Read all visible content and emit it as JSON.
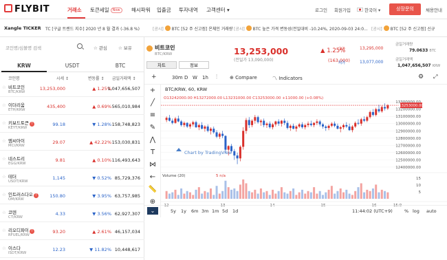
{
  "brand": {
    "name": "FLYBIT"
  },
  "nav": {
    "items": [
      {
        "label": "거래소",
        "active": true
      },
      {
        "label": "토큰세일",
        "badge": "Now"
      },
      {
        "label": "해시파워"
      },
      {
        "label": "입출금"
      },
      {
        "label": "투자내역"
      },
      {
        "label": "고객센터 ▾"
      }
    ],
    "login": "로그인",
    "signup": "회원가입",
    "language": "한국어 ▾",
    "cta": "상장문의",
    "recruit": "채용안내"
  },
  "ticker": {
    "title": "Xangle TICKER",
    "items": [
      {
        "text": "TC [구글 트렌드 지수] 2020 년 8 월 결과 (-36.8 %)"
      },
      {
        "tag": "[공시]",
        "coin": "BTC",
        "text": "[52 주 신고점] 온체인 거래량"
      },
      {
        "tag": "[공시]",
        "coin": "BTC",
        "text": "높은 가격 변동성(전일대비 -10.24%, 2020-09-03 24:0..."
      },
      {
        "tag": "[공시]",
        "coin": "BTC",
        "text": "[52 주 신고점] 신규"
      }
    ]
  },
  "market": {
    "search_placeholder": "코인명/심볼명 검색",
    "favorites": "관심",
    "holdings": "보유",
    "tabs": [
      "KRW",
      "USDT",
      "BTC"
    ],
    "columns": [
      "코인명",
      "시세 ↕",
      "변동률 ↕",
      "금일거래액 ↕"
    ],
    "rows": [
      {
        "name": "비트코인",
        "code": "BTC/KRW",
        "price": "13,253,000",
        "change": "▲ 1.25%",
        "dir": "up",
        "volume": "1,047,656,507"
      },
      {
        "name": "이더리움",
        "code": "ETH/KRW",
        "price": "435,400",
        "change": "▲ 0.69%",
        "dir": "up",
        "volume": "565,010,984"
      },
      {
        "name": "키보드토큰",
        "code": "KEYT/KRW",
        "price": "99.18",
        "change": "▼ 1.28%",
        "dir": "dn",
        "volume": "158,748,823",
        "warn": true
      },
      {
        "name": "엠씨아이",
        "code": "MCI/KRW",
        "price": "29.07",
        "change": "▲ 42.22%",
        "dir": "up",
        "volume": "153,030,831"
      },
      {
        "name": "네스트리",
        "code": "EGG/KRW",
        "price": "9.81",
        "change": "▲ 0.10%",
        "dir": "up",
        "volume": "116,493,643"
      },
      {
        "name": "테더",
        "code": "USDT/KRW",
        "price": "1,145",
        "change": "▼ 0.52%",
        "dir": "dn",
        "volume": "85,729,376"
      },
      {
        "name": "인트러스다오",
        "code": "OM/KRW",
        "price": "150.80",
        "change": "▼ 3.95%",
        "dir": "dn",
        "volume": "63,757,985",
        "warn": true
      },
      {
        "name": "코텐",
        "code": "CT/KRW",
        "price": "4.33",
        "change": "▼ 3.56%",
        "dir": "dn",
        "volume": "62,927,307"
      },
      {
        "name": "리오디파이",
        "code": "RFUEL/KRW",
        "price": "93.20",
        "change": "▲ 2.61%",
        "dir": "up",
        "volume": "46,157,034",
        "warn": true
      },
      {
        "name": "이스다",
        "code": "ISDT/KRW",
        "price": "12.23",
        "change": "▼ 11.82%",
        "dir": "dn",
        "volume": "10,448,617"
      }
    ]
  },
  "detail": {
    "name": "비트코인",
    "code": "BTC/KRW",
    "price": "13,253,000",
    "prev": "(전일가 13,090,000)",
    "change_pct": "▲ 1.25%",
    "change_abs": "(163,000)",
    "high_label": "고가",
    "high": "13,295,000",
    "low_label": "저가",
    "low": "13,077,000",
    "volume_label": "금일거래량",
    "volume": "79.0633",
    "volume_unit": "BTC",
    "amount_label": "금일거래액",
    "amount": "1,047,656,507",
    "amount_unit": "KRW",
    "tabs": [
      "차트",
      "정보"
    ]
  },
  "chart_toolbar": {
    "intervals": [
      "30m",
      "D",
      "W",
      "1h"
    ],
    "compare": "Compare",
    "indicators": "Indicators"
  },
  "chart_data": {
    "type": "candlestick",
    "symbol": "BTC/KRW, 60, KRW",
    "ohlc_text": "O13242000.00  H13272000.00  L13231000.00  C13253000.00  +11000.00 (+0.08%)",
    "watermark": "Chart by TradingView",
    "last_price_label": "13253000.00",
    "y_ticks": [
      13300000,
      13200000,
      13100000,
      13000000,
      12900000,
      12800000,
      12700000,
      12600000,
      12500000,
      12400000
    ],
    "y_tick_labels": [
      "13300000.00",
      "13200000.00",
      "13100000.00",
      "13000000.00",
      "12900000.00",
      "12800000.00",
      "12700000.00",
      "12600000.00",
      "12500000.00",
      "12400000.00"
    ],
    "x_tick_labels": [
      "12",
      "13",
      "14",
      "15",
      "16",
      "15:0"
    ],
    "volume_label": "Volume (20)",
    "volume_value": "5  n/a",
    "volume_ticks": [
      "15",
      "10",
      "5"
    ],
    "candles": [
      [
        13050000,
        13100000,
        13020000,
        13080000
      ],
      [
        13080000,
        13120000,
        13030000,
        13040000
      ],
      [
        13040000,
        13070000,
        12990000,
        13010000
      ],
      [
        13010000,
        13090000,
        13000000,
        13070000
      ],
      [
        13070000,
        13110000,
        13020000,
        13030000
      ],
      [
        13030000,
        13050000,
        12960000,
        12980000
      ],
      [
        12980000,
        13030000,
        12950000,
        13010000
      ],
      [
        13010000,
        13020000,
        12940000,
        12960000
      ],
      [
        12960000,
        13010000,
        12930000,
        12990000
      ],
      [
        12990000,
        13040000,
        12960000,
        13020000
      ],
      [
        13020000,
        13040000,
        12940000,
        12950000
      ],
      [
        12950000,
        13000000,
        12910000,
        12980000
      ],
      [
        12980000,
        13020000,
        12920000,
        12930000
      ],
      [
        12930000,
        12980000,
        12890000,
        12960000
      ],
      [
        12960000,
        12990000,
        12880000,
        12900000
      ],
      [
        12900000,
        12950000,
        12850000,
        12930000
      ],
      [
        12930000,
        12960000,
        12860000,
        12880000
      ],
      [
        12880000,
        12910000,
        12800000,
        12820000
      ],
      [
        12820000,
        12880000,
        12790000,
        12860000
      ],
      [
        12860000,
        12900000,
        12800000,
        12830000
      ],
      [
        12830000,
        12840000,
        12600000,
        12640000
      ],
      [
        12640000,
        12700000,
        12560000,
        12690000
      ],
      [
        12690000,
        12720000,
        12600000,
        12620000
      ],
      [
        12620000,
        12650000,
        12500000,
        12560000
      ],
      [
        12560000,
        12600000,
        12440000,
        12520000
      ],
      [
        12520000,
        12700000,
        12480000,
        12680000
      ],
      [
        12680000,
        12950000,
        12640000,
        12900000
      ],
      [
        12900000,
        13080000,
        12860000,
        13050000
      ],
      [
        13050000,
        13090000,
        12940000,
        12980000
      ],
      [
        12980000,
        13060000,
        12950000,
        13040000
      ],
      [
        13040000,
        13120000,
        13000000,
        13090000
      ],
      [
        13090000,
        13110000,
        13000000,
        13020000
      ],
      [
        13020000,
        13060000,
        12970000,
        13040000
      ],
      [
        13040000,
        13070000,
        12950000,
        12980000
      ],
      [
        12980000,
        13020000,
        12940000,
        13000000
      ],
      [
        13000000,
        13030000,
        12930000,
        12950000
      ],
      [
        12950000,
        13010000,
        12920000,
        12990000
      ],
      [
        12990000,
        13040000,
        12960000,
        13030000
      ],
      [
        13030000,
        13060000,
        12970000,
        13000000
      ],
      [
        13000000,
        13050000,
        12960000,
        13040000
      ],
      [
        13040000,
        13070000,
        12980000,
        13010000
      ],
      [
        13010000,
        13040000,
        12920000,
        12940000
      ],
      [
        12940000,
        12990000,
        12900000,
        12970000
      ],
      [
        12970000,
        13000000,
        12920000,
        12930000
      ],
      [
        12930000,
        12980000,
        12890000,
        12960000
      ],
      [
        12960000,
        13010000,
        12940000,
        12990000
      ],
      [
        12990000,
        13020000,
        12930000,
        12950000
      ],
      [
        12950000,
        13000000,
        12920000,
        12980000
      ],
      [
        12980000,
        13030000,
        12950000,
        13000000
      ],
      [
        13000000,
        13040000,
        12960000,
        12980000
      ],
      [
        12980000,
        13020000,
        12950000,
        13010000
      ],
      [
        13010000,
        13060000,
        12980000,
        13030000
      ],
      [
        13030000,
        13050000,
        12960000,
        12990000
      ],
      [
        12990000,
        13010000,
        12930000,
        12960000
      ],
      [
        12960000,
        12980000,
        12900000,
        12940000
      ],
      [
        12940000,
        12990000,
        12910000,
        12970000
      ],
      [
        12970000,
        13020000,
        12950000,
        13000000
      ],
      [
        13000000,
        13030000,
        12950000,
        12970000
      ],
      [
        12970000,
        13000000,
        12920000,
        12930000
      ],
      [
        12930000,
        12970000,
        12880000,
        12950000
      ],
      [
        12950000,
        13000000,
        12920000,
        12980000
      ],
      [
        12980000,
        13020000,
        12940000,
        12960000
      ],
      [
        12960000,
        13000000,
        12900000,
        12910000
      ],
      [
        12910000,
        12980000,
        12880000,
        12960000
      ],
      [
        12960000,
        13030000,
        12940000,
        13010000
      ],
      [
        13010000,
        13060000,
        12980000,
        13000000
      ],
      [
        13000000,
        13080000,
        12970000,
        13060000
      ],
      [
        13060000,
        13100000,
        13020000,
        13040000
      ],
      [
        13040000,
        13110000,
        13020000,
        13090000
      ],
      [
        13090000,
        13180000,
        13070000,
        13160000
      ],
      [
        13160000,
        13200000,
        13100000,
        13120000
      ],
      [
        13120000,
        13220000,
        13100000,
        13200000
      ],
      [
        13200000,
        13260000,
        13150000,
        13170000
      ],
      [
        13170000,
        13250000,
        13150000,
        13230000
      ],
      [
        13230000,
        13280000,
        13180000,
        13210000
      ],
      [
        13210000,
        13270000,
        13190000,
        13253000
      ]
    ],
    "volumes": [
      6,
      4,
      5,
      7,
      3,
      8,
      4,
      6,
      5,
      3,
      7,
      9,
      4,
      6,
      5,
      8,
      3,
      10,
      4,
      6,
      14,
      9,
      7,
      8,
      6,
      11,
      15,
      12,
      6,
      5,
      7,
      4,
      8,
      5,
      6,
      3,
      7,
      4,
      6,
      9,
      5,
      4,
      6,
      8,
      3,
      5,
      7,
      4,
      6,
      5,
      9,
      4,
      6,
      3,
      5,
      7,
      10,
      4,
      6,
      8,
      5,
      7,
      4,
      3,
      6,
      9,
      12,
      5,
      7,
      6,
      8,
      11,
      5,
      7,
      6,
      5
    ]
  },
  "bottom_bar": {
    "ranges": [
      "5y",
      "1y",
      "6m",
      "3m",
      "1m",
      "5d",
      "1d"
    ],
    "time": "11:44:02 (UTC+9)",
    "options": [
      "%",
      "log",
      "auto"
    ]
  },
  "colors": {
    "accent": "#e23a3a",
    "up": "#d9302b",
    "down": "#2a63c8"
  }
}
